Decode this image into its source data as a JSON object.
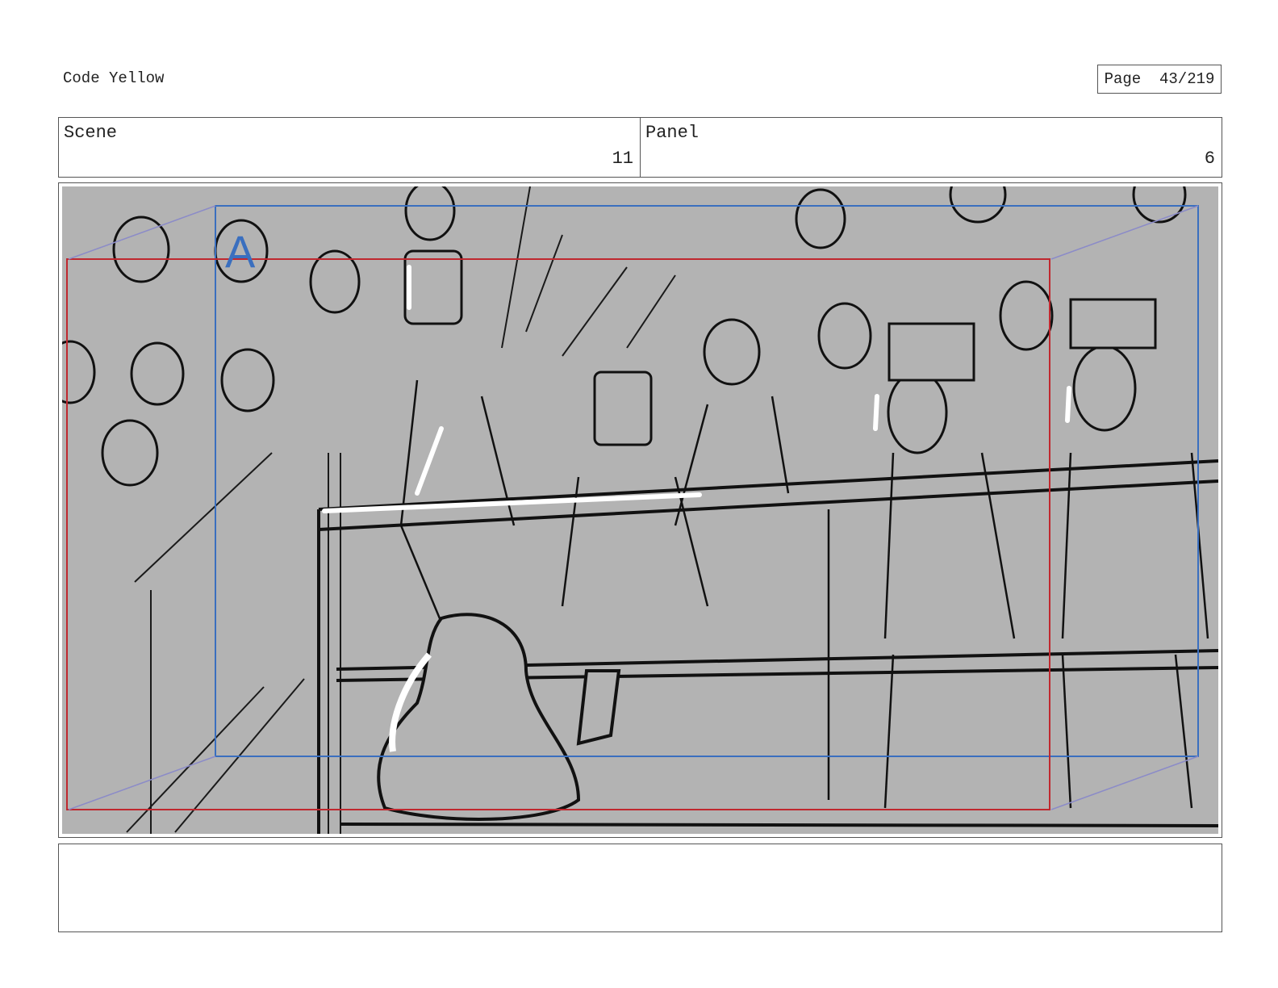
{
  "document": {
    "title": "Code Yellow",
    "page_label": "Page  43/219"
  },
  "header": {
    "scene_label": "Scene",
    "scene_value": "11",
    "panel_label": "Panel",
    "panel_value": "6"
  },
  "frame": {
    "annotation_letter": "A",
    "colors": {
      "background": "#b3b3b3",
      "safe_area": "#c0282f",
      "camera_move": "#3a6fbf",
      "arrow": "#8b8bc8"
    }
  },
  "notes": {
    "text": ""
  }
}
